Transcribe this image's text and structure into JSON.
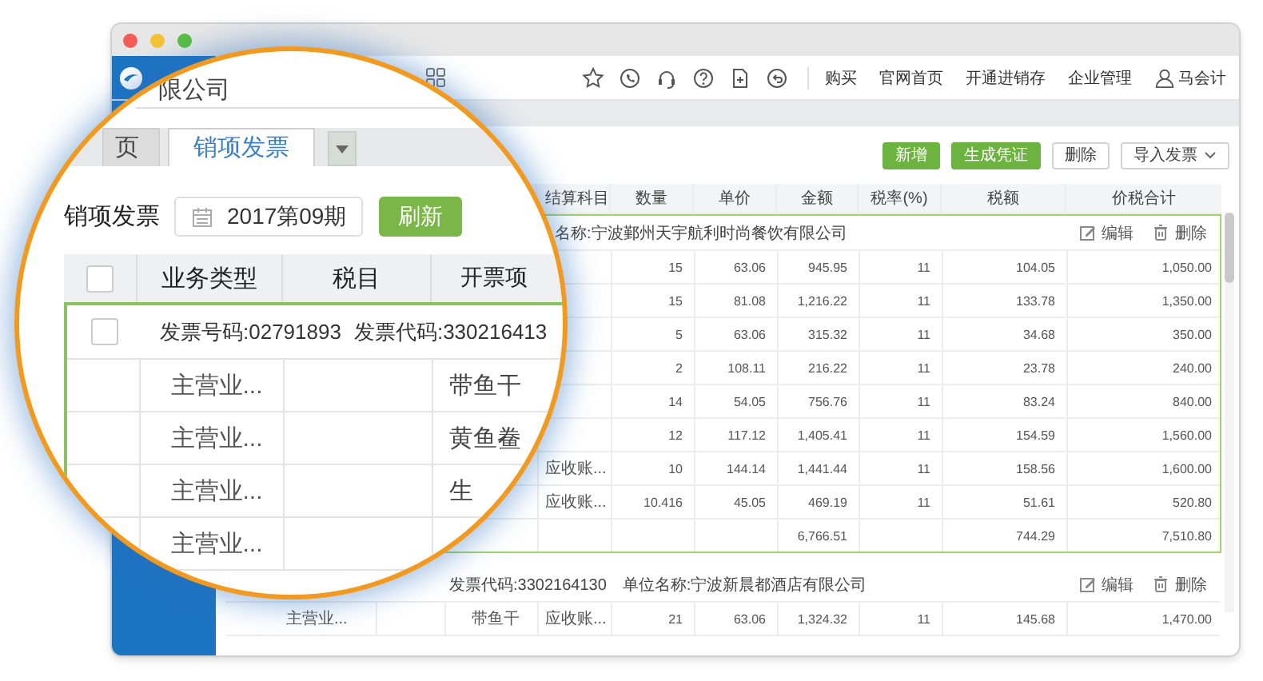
{
  "header": {
    "company": "限公司",
    "links": [
      "购买",
      "官网首页",
      "开通进销存",
      "企业管理"
    ],
    "user": "马会计"
  },
  "tabs": [
    {
      "label": "页",
      "selected": false
    },
    {
      "label": "销项发票",
      "selected": true
    }
  ],
  "filter": {
    "label": "销项发票",
    "period": "2017第09期",
    "refresh": "刷新"
  },
  "zoom_table": {
    "columns": [
      "业务类型",
      "税目",
      "开票项"
    ],
    "select_all": {
      "checked": false
    },
    "group": {
      "checked": false,
      "selected": true,
      "invoice_no": "发票号码:02791893",
      "invoice_code": "发票代码:330216413",
      "rows": [
        {
          "business_type": "主营业...",
          "item": "带鱼干"
        },
        {
          "business_type": "主营业...",
          "item": "黄鱼鲞"
        },
        {
          "business_type": "主营业...",
          "item": "生"
        },
        {
          "business_type": "主营业..."
        }
      ]
    }
  },
  "toolbar": [
    {
      "label": "新增",
      "kind": "primary"
    },
    {
      "label": "生成凭证",
      "kind": "primary"
    },
    {
      "label": "删除",
      "kind": "default"
    },
    {
      "label": "导入发票",
      "kind": "dropdown"
    }
  ],
  "table": {
    "columns": [
      "结算科目",
      "数量",
      "单价",
      "金额",
      "税率(%)",
      "税额",
      "价税合计"
    ],
    "groups": [
      {
        "selected": true,
        "customer": "名称:宁波鄞州天宇航利时尚餐饮有限公司",
        "actions": [
          {
            "label": "编辑",
            "kind": "edit"
          },
          {
            "label": "删除",
            "kind": "delete"
          }
        ],
        "rows": [
          {
            "qty": "15",
            "price": "63.06",
            "amount": "945.95",
            "rate": "11",
            "tax": "104.05",
            "total": "1,050.00"
          },
          {
            "qty": "15",
            "price": "81.08",
            "amount": "1,216.22",
            "rate": "11",
            "tax": "133.78",
            "total": "1,350.00"
          },
          {
            "qty": "5",
            "price": "63.06",
            "amount": "315.32",
            "rate": "11",
            "tax": "34.68",
            "total": "350.00"
          },
          {
            "qty": "2",
            "price": "108.11",
            "amount": "216.22",
            "rate": "11",
            "tax": "23.78",
            "total": "240.00"
          },
          {
            "qty": "14",
            "price": "54.05",
            "amount": "756.76",
            "rate": "11",
            "tax": "83.24",
            "total": "840.00"
          },
          {
            "qty": "12",
            "price": "117.12",
            "amount": "1,405.41",
            "rate": "11",
            "tax": "154.59",
            "total": "1,560.00"
          },
          {
            "account": "应收账...",
            "qty": "10",
            "price": "144.14",
            "amount": "1,441.44",
            "rate": "11",
            "tax": "158.56",
            "total": "1,600.00"
          },
          {
            "account": "应收账...",
            "qty": "10.416",
            "price": "45.05",
            "amount": "469.19",
            "rate": "11",
            "tax": "51.61",
            "total": "520.80"
          }
        ],
        "total": {
          "amount": "6,766.51",
          "tax": "744.29",
          "total": "7,510.80"
        }
      },
      {
        "selected": false,
        "invoice_code": "发票代码:3302164130",
        "customer": "单位名称:宁波新晨都酒店有限公司",
        "actions": [
          {
            "label": "编辑",
            "kind": "edit"
          },
          {
            "label": "删除",
            "kind": "delete"
          }
        ],
        "rows": [
          {
            "business_type": "主营业...",
            "item": "带鱼干",
            "account": "应收账...",
            "qty": "21",
            "price": "63.06",
            "amount": "1,324.32",
            "rate": "11",
            "tax": "145.68",
            "total": "1,470.00"
          }
        ]
      }
    ]
  }
}
